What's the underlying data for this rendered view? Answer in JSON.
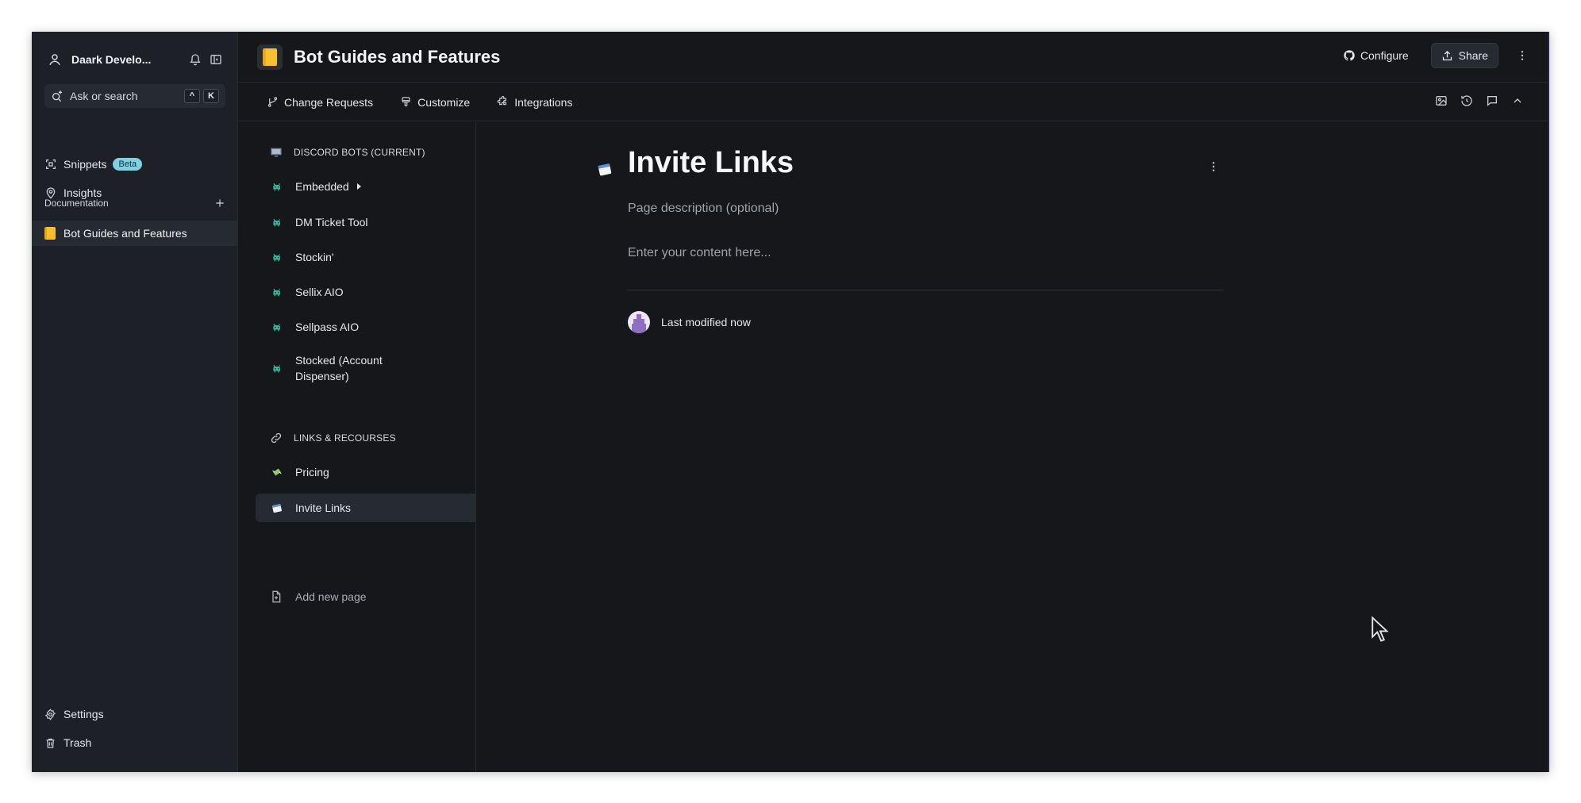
{
  "sidebar": {
    "space_name": "Daark Develo...",
    "search_label": "Ask or search",
    "search_keys": [
      "^",
      "K"
    ],
    "nav": [
      {
        "label": "Snippets",
        "badge": "Beta"
      },
      {
        "label": "Insights"
      }
    ],
    "section_label": "Documentation",
    "doc_item": "Bot Guides and Features",
    "bottom": [
      {
        "label": "Settings"
      },
      {
        "label": "Trash"
      }
    ]
  },
  "header": {
    "title": "Bot Guides and Features",
    "configure": "Configure",
    "share": "Share"
  },
  "toolbar": {
    "items": [
      "Change Requests",
      "Customize",
      "Integrations"
    ]
  },
  "tree": {
    "groups": [
      {
        "title": "DISCORD BOTS (CURRENT)",
        "pages": [
          "Embedded",
          "DM Ticket Tool",
          "Stockin'",
          "Sellix AIO",
          "Sellpass AIO",
          "Stocked (Account Dispenser)"
        ]
      },
      {
        "title": "LINKS & RECOURSES",
        "pages": [
          "Pricing",
          "Invite Links"
        ]
      }
    ],
    "add_page": "Add new page",
    "active_page": "Invite Links"
  },
  "page": {
    "title": "Invite Links",
    "description_placeholder": "Page description (optional)",
    "content_placeholder": "Enter your content here...",
    "last_modified": "Last modified now"
  },
  "colors": {
    "bg": "#15171b",
    "sidebar": "#1d2026",
    "beta_badge": "#7fd0e3",
    "bot_icon": "#3bb59a",
    "ai_icon": "#19b087"
  }
}
